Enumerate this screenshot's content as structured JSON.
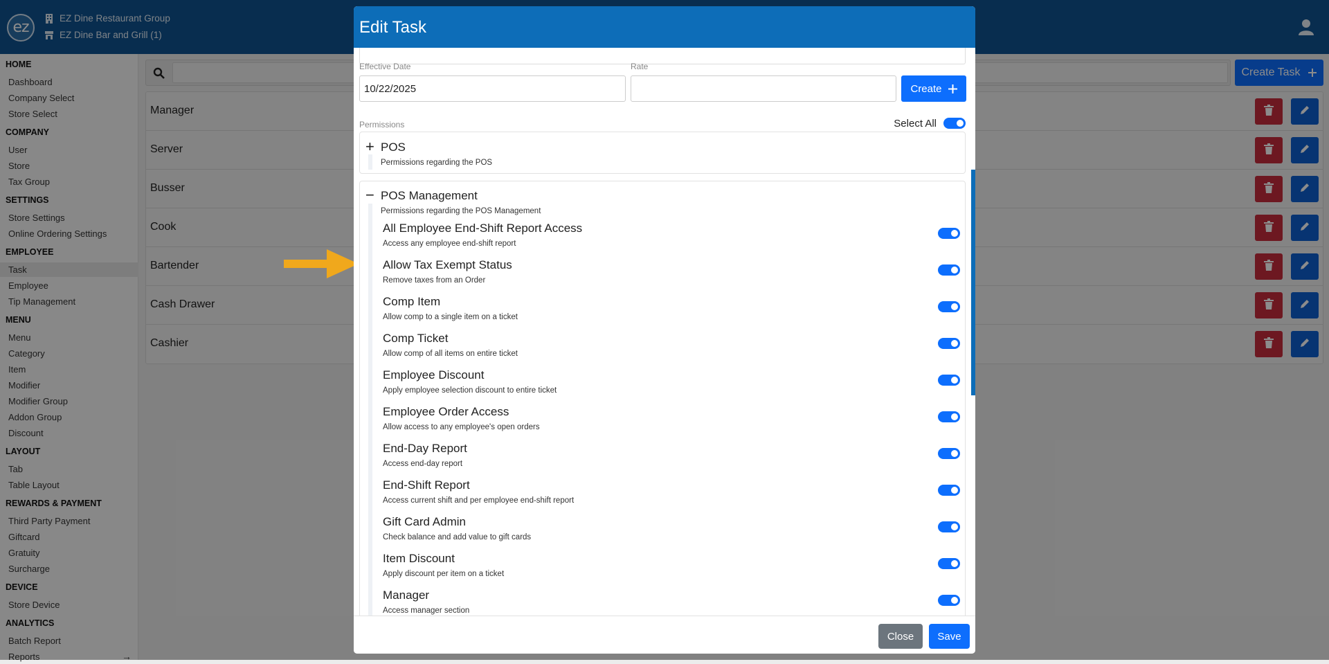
{
  "header": {
    "logo_text": "ez",
    "org_name": "EZ Dine Restaurant Group",
    "store_name": "EZ Dine Bar and Grill (1)"
  },
  "sidebar": {
    "sections": [
      {
        "title": "HOME",
        "items": [
          "Dashboard",
          "Company Select",
          "Store Select"
        ]
      },
      {
        "title": "COMPANY",
        "items": [
          "User",
          "Store",
          "Tax Group"
        ]
      },
      {
        "title": "SETTINGS",
        "items": [
          "Store Settings",
          "Online Ordering Settings"
        ]
      },
      {
        "title": "EMPLOYEE",
        "items": [
          "Task",
          "Employee",
          "Tip Management"
        ]
      },
      {
        "title": "MENU",
        "items": [
          "Menu",
          "Category",
          "Item",
          "Modifier",
          "Modifier Group",
          "Addon Group",
          "Discount"
        ]
      },
      {
        "title": "LAYOUT",
        "items": [
          "Tab",
          "Table Layout"
        ]
      },
      {
        "title": "REWARDS & PAYMENT",
        "items": [
          "Third Party Payment",
          "Giftcard",
          "Gratuity",
          "Surcharge"
        ]
      },
      {
        "title": "DEVICE",
        "items": [
          "Store Device"
        ]
      },
      {
        "title": "ANALYTICS",
        "items": [
          "Batch Report",
          "Reports"
        ]
      }
    ],
    "active_item": "Task"
  },
  "main": {
    "create_task_label": "Create Task",
    "tasks": [
      "Manager",
      "Server",
      "Busser",
      "Cook",
      "Bartender",
      "Cash Drawer",
      "Cashier"
    ]
  },
  "modal": {
    "title": "Edit Task",
    "effective_date_label": "Effective Date",
    "effective_date_value": "10/22/2025",
    "rate_label": "Rate",
    "rate_value": "",
    "create_label": "Create",
    "permissions_label": "Permissions",
    "select_all_label": "Select All",
    "select_all_on": true,
    "sections": [
      {
        "sign": "+",
        "title": "POS",
        "desc": "Permissions regarding the POS",
        "expanded": false
      },
      {
        "sign": "−",
        "title": "POS Management",
        "desc": "Permissions regarding the POS Management",
        "expanded": true
      }
    ],
    "permissions": [
      {
        "title": "All Employee End-Shift Report Access",
        "desc": "Access any employee end-shift report",
        "on": true
      },
      {
        "title": "Allow Tax Exempt Status",
        "desc": "Remove taxes from an Order",
        "on": true
      },
      {
        "title": "Comp Item",
        "desc": "Allow comp to a single item on a ticket",
        "on": true
      },
      {
        "title": "Comp Ticket",
        "desc": "Allow comp of all items on entire ticket",
        "on": true
      },
      {
        "title": "Employee Discount",
        "desc": "Apply employee selection discount to entire ticket",
        "on": true
      },
      {
        "title": "Employee Order Access",
        "desc": "Allow access to any employee's open orders",
        "on": true
      },
      {
        "title": "End-Day Report",
        "desc": "Access end-day report",
        "on": true
      },
      {
        "title": "End-Shift Report",
        "desc": "Access current shift and per employee end-shift report",
        "on": true
      },
      {
        "title": "Gift Card Admin",
        "desc": "Check balance and add value to gift cards",
        "on": true
      },
      {
        "title": "Item Discount",
        "desc": "Apply discount per item on a ticket",
        "on": true
      },
      {
        "title": "Manager",
        "desc": "Access manager section",
        "on": true
      }
    ],
    "close_label": "Close",
    "save_label": "Save"
  },
  "colors": {
    "header_blue": "#0f5390",
    "modal_header_blue": "#0d6db8",
    "primary_blue": "#0d6efd",
    "danger_red": "#c62d3d",
    "secondary_gray": "#6c757d",
    "arrow_orange": "#f0a81c"
  },
  "icons": {
    "org": "building-icon",
    "store": "store-icon",
    "user": "user-icon",
    "search": "search-icon",
    "delete": "trash-icon",
    "edit": "pencil-icon",
    "plus": "plus-icon",
    "reports_arrow": "arrow-right-icon"
  }
}
